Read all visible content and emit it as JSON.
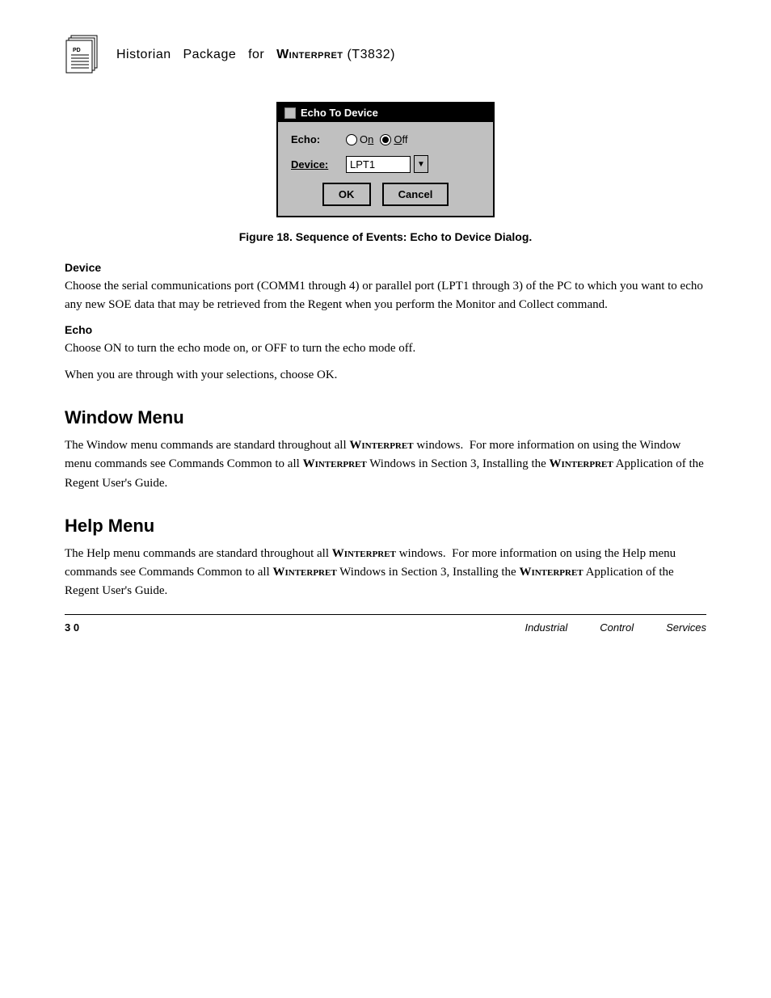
{
  "header": {
    "title_prefix": "Historian  Package  for  ",
    "title_brand": "Winterpret",
    "title_suffix": " (T3832)"
  },
  "dialog": {
    "title": "Echo To Device",
    "echo_label": "Echo:",
    "on_label": "On",
    "off_label": "Off",
    "device_label": "Device:",
    "device_value": "LPT1",
    "ok_label": "OK",
    "cancel_label": "Cancel"
  },
  "figure": {
    "caption": "Figure 18.  Sequence of Events: Echo to Device Dialog."
  },
  "sections": [
    {
      "heading": "Device",
      "text": "Choose the serial communications port (COMM1 through 4) or parallel port (LPT1 through 3) of the PC to which you want to echo any new SOE data that may be retrieved from the Regent when you perform the Monitor and Collect command."
    },
    {
      "heading": "Echo",
      "text": "Choose ON to turn the echo mode on, or OFF to turn the echo mode off."
    }
  ],
  "ok_note": "When you are through with your selections, choose OK.",
  "window_menu": {
    "heading": "Window Menu",
    "text": "The Window menu commands are standard throughout all WINTERPRET windows.  For more information on using the Window menu commands see Commands Common to all WINTERPRET Windows in Section 3, Installing the WINTERPRET Application of the Regent User's Guide."
  },
  "help_menu": {
    "heading": "Help Menu",
    "text": "The Help menu commands are standard throughout all WINTERPRET windows.  For more information on using the Help menu commands see Commands Common to all WINTERPRET Windows in Section 3, Installing the WINTERPRET Application of the Regent User's Guide."
  },
  "footer": {
    "page_number": "3 0",
    "col1": "Industrial",
    "col2": "Control",
    "col3": "Services"
  }
}
